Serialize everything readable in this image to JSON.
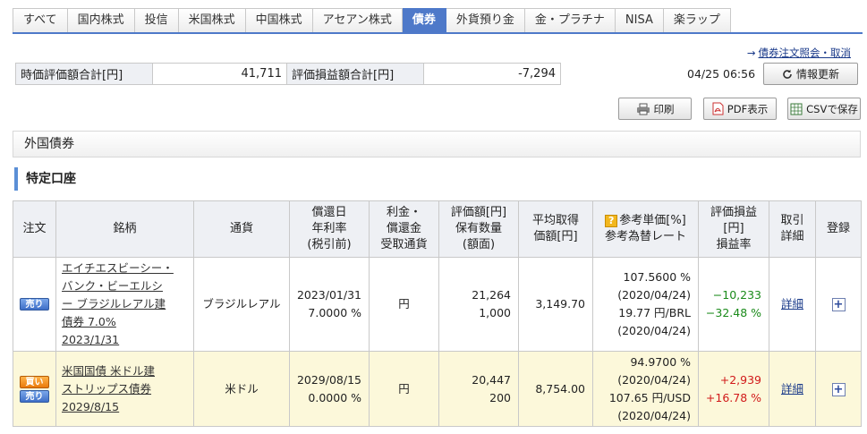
{
  "tabs": [
    "すべて",
    "国内株式",
    "投信",
    "米国株式",
    "中国株式",
    "アセアン株式",
    "債券",
    "外貨預り金",
    "金・プラチナ",
    "NISA",
    "楽ラップ"
  ],
  "active_tab": "債券",
  "links": {
    "order_inquiry": "債券注文照会・取消"
  },
  "summary": {
    "market_value_label": "時価評価額合計[円]",
    "market_value": "41,711",
    "pl_label": "評価損益額合計[円]",
    "pl_value": "-7,294"
  },
  "timestamp": "04/25 06:56",
  "buttons": {
    "refresh": "情報更新",
    "print": "印刷",
    "pdf": "PDF表示",
    "csv": "CSVで保存"
  },
  "section_title": "外国債券",
  "account_title": "特定口座",
  "table": {
    "headers": {
      "order": "注文",
      "brand": "銘柄",
      "currency": "通貨",
      "redemption_1": "償還日",
      "redemption_2": "年利率",
      "redemption_3": "(税引前)",
      "interest_1": "利金・",
      "interest_2": "償還金",
      "interest_3": "受取通貨",
      "valuation_1": "評価額[円]",
      "valuation_2": "保有数量",
      "valuation_3": "(額面)",
      "avg_1": "平均取得",
      "avg_2": "価額[円]",
      "ref_1": "参考単価[%]",
      "ref_2": "参考為替レート",
      "pl_1": "評価損益",
      "pl_2": "[円]",
      "pl_3": "損益率",
      "trade_1": "取引",
      "trade_2": "詳細",
      "register": "登録"
    },
    "rows": [
      {
        "sell_label": "売り",
        "brand_line1": "エイチエスビーシー・",
        "brand_line2": "バンク・ビーエルシ",
        "brand_line3": "ー ブラジルレアル建",
        "brand_line4": "債券 7.0%",
        "brand_date": "2023/1/31",
        "currency": "ブラジルレアル",
        "redemption_date": "2023/01/31",
        "rate": "7.0000 %",
        "receive_currency": "円",
        "valuation": "21,264",
        "quantity": "1,000",
        "avg_price": "3,149.70",
        "ref_price": "107.5600 %",
        "ref_price_date": "(2020/04/24)",
        "ref_fx": "19.77 円/BRL",
        "ref_fx_date": "(2020/04/24)",
        "pl": "−10,233",
        "pl_rate": "−32.48 %",
        "detail": "詳細"
      },
      {
        "buy_label": "買い",
        "sell_label": "売り",
        "brand_line1": "米国国債 米ドル建",
        "brand_line2": "ストリップス債券",
        "brand_date": "2029/8/15",
        "currency": "米ドル",
        "redemption_date": "2029/08/15",
        "rate": "0.0000 %",
        "receive_currency": "円",
        "valuation": "20,447",
        "quantity": "200",
        "avg_price": "8,754.00",
        "ref_price": "94.9700 %",
        "ref_price_date": "(2020/04/24)",
        "ref_fx": "107.65 円/USD",
        "ref_fx_date": "(2020/04/24)",
        "pl": "+2,939",
        "pl_rate": "+16.78 %",
        "detail": "詳細"
      }
    ]
  },
  "colors": {
    "accent": "#4e79c9",
    "gain": "#1a8a1a",
    "loss": "#d11a1a",
    "highlight_row": "#fcf8da"
  }
}
